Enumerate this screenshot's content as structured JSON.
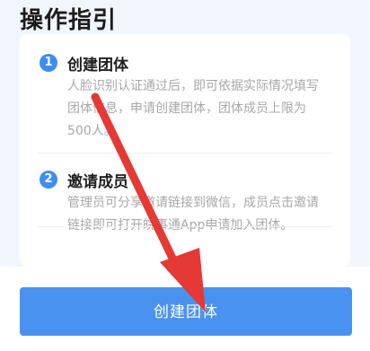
{
  "page": {
    "title": "操作指引"
  },
  "steps": [
    {
      "number": "1",
      "title": "创建团体",
      "description": "人脸识别认证通过后，即可依据实际情况填写团体信息，申请创建团体，团体成员上限为500人。"
    },
    {
      "number": "2",
      "title": "邀请成员",
      "description": "管理员可分享邀请链接到微信，成员点击邀请链接即可打开皖事通App申请加入团体。"
    }
  ],
  "footer": {
    "create_button_label": "创建团体"
  },
  "colors": {
    "accent": "#4a92f0",
    "badge": "#3d8df5",
    "annotation_arrow": "#e53935",
    "page_background": "#f1f5fc"
  }
}
